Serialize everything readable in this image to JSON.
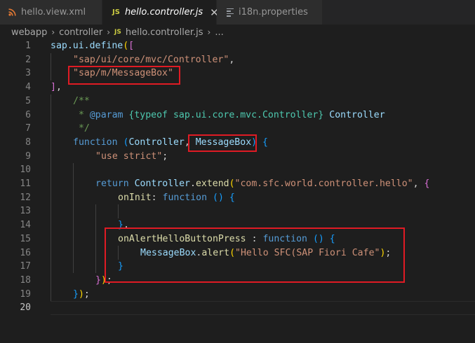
{
  "tabs": [
    {
      "label": "hello.view.xml"
    },
    {
      "label": "hello.controller.js"
    },
    {
      "label": "i18n.properties"
    }
  ],
  "breadcrumb": [
    "webapp",
    "controller",
    "hello.controller.js",
    "..."
  ],
  "line_numbers": [
    "1",
    "2",
    "3",
    "4",
    "5",
    "6",
    "7",
    "8",
    "9",
    "10",
    "11",
    "12",
    "13",
    "14",
    "15",
    "16",
    "17",
    "18",
    "19",
    "20"
  ],
  "code": {
    "l1": {
      "a": "sap.ui.define",
      "b": "(",
      "c": "["
    },
    "l2": {
      "a": "\"sap/ui/core/mvc/Controller\"",
      "b": ","
    },
    "l3": {
      "a": "\"sap/m/MessageBox\""
    },
    "l4": {
      "a": "]",
      "b": ","
    },
    "l5": {
      "a": "/**"
    },
    "l6": {
      "a": " * ",
      "b": "@param",
      "c": " ",
      "d": "{typeof sap.ui.core.mvc.Controller}",
      "e": " ",
      "f": "Controller"
    },
    "l7": {
      "a": " */"
    },
    "l8": {
      "a": "function",
      "b": " ",
      "c": "(",
      "d": "Controller",
      "e": ", ",
      "f": "MessageBox",
      "g": ")",
      "h": " ",
      "i": "{"
    },
    "l9": {
      "a": "\"use strict\"",
      "b": ";"
    },
    "l11": {
      "a": "return",
      "b": " ",
      "c": "Controller",
      "d": ".",
      "e": "extend",
      "f": "(",
      "g": "\"com.sfc.world.controller.hello\"",
      "h": ", ",
      "i": "{"
    },
    "l12": {
      "a": "onInit",
      "b": ": ",
      "c": "function",
      "d": " ",
      "e": "()",
      "f": " ",
      "g": "{"
    },
    "l14": {
      "a": "}",
      "b": ","
    },
    "l15": {
      "a": "onAlertHelloButtonPress",
      "b": " : ",
      "c": "function",
      "d": " ",
      "e": "()",
      "f": " ",
      "g": "{"
    },
    "l16": {
      "a": "MessageBox",
      "b": ".",
      "c": "alert",
      "d": "(",
      "e": "\"Hello SFC(SAP Fiori Cafe\"",
      "f": ")",
      "g": ";"
    },
    "l17": {
      "a": "}"
    },
    "l18": {
      "a": "}",
      "b": ")",
      "c": ";"
    },
    "l19": {
      "a": "}",
      "b": ")",
      "c": ";"
    }
  },
  "colors": {
    "editor_bg": "#1e1e1e",
    "highlight_box": "#e01b24",
    "keyword": "#569cd6",
    "string": "#ce9178",
    "comment": "#6a9955"
  },
  "icons": [
    "rss-icon",
    "js-icon",
    "close-icon",
    "lines-icon",
    "chevron-right-icon"
  ]
}
